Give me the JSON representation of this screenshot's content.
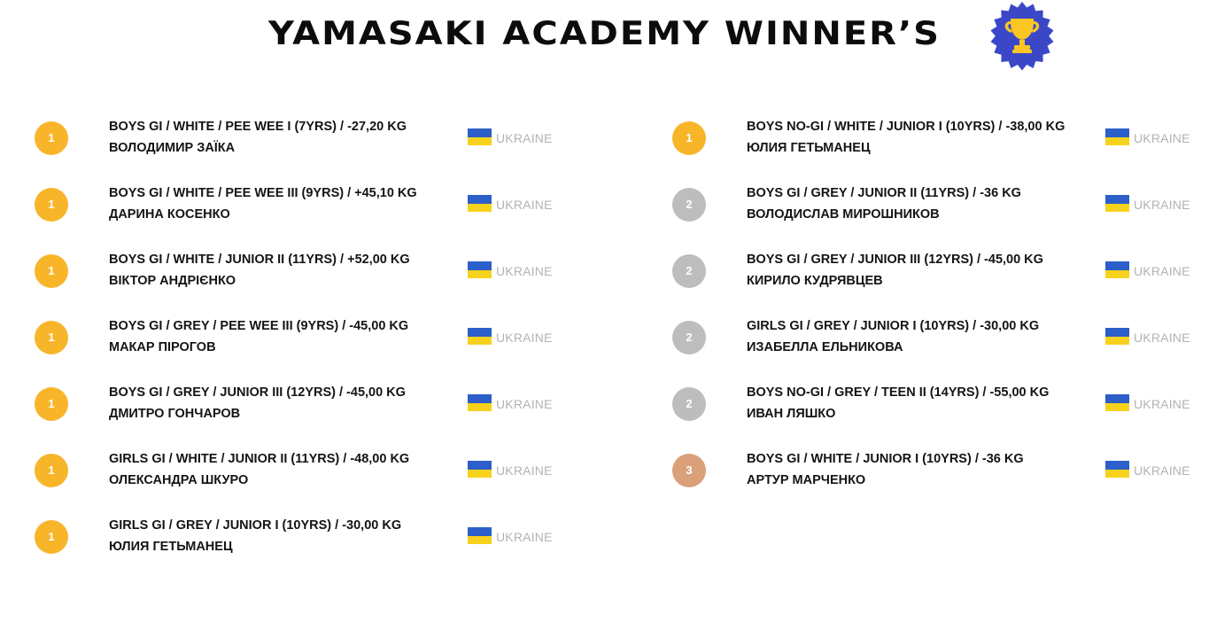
{
  "header": {
    "title": "YAMASAKI ACADEMY WINNER’S",
    "badge_icon": "trophy-icon",
    "badge_color": "#3a48c8",
    "trophy_color": "#f9c623"
  },
  "colors": {
    "gold": "#f9b529",
    "silver": "#bdbdbd",
    "bronze": "#d9a07a",
    "flag_blue": "#2c5fc9",
    "flag_yellow": "#f7d21c"
  },
  "results_left": [
    {
      "place": "1",
      "medal": "gold",
      "category": "BOYS GI / WHITE / PEE WEE I (7YRS) / -27,20 KG",
      "athlete": "ВОЛОДИМИР ЗАЇКА",
      "country": "UKRAINE"
    },
    {
      "place": "1",
      "medal": "gold",
      "category": "BOYS GI / WHITE / PEE WEE III (9YRS) / +45,10 KG",
      "athlete": "ДАРИНА КОСЕНКО",
      "country": "UKRAINE"
    },
    {
      "place": "1",
      "medal": "gold",
      "category": "BOYS GI / WHITE / JUNIOR II (11YRS) / +52,00 KG",
      "athlete": "ВІКТОР АНДРІЄНКО",
      "country": "UKRAINE"
    },
    {
      "place": "1",
      "medal": "gold",
      "category": "BOYS GI / GREY / PEE WEE III (9YRS) / -45,00 KG",
      "athlete": "МАКАР ПІРОГОВ",
      "country": "UKRAINE"
    },
    {
      "place": "1",
      "medal": "gold",
      "category": "BOYS GI / GREY / JUNIOR III (12YRS) / -45,00 KG",
      "athlete": "ДМИТРО ГОНЧАРОВ",
      "country": "UKRAINE"
    },
    {
      "place": "1",
      "medal": "gold",
      "category": "GIRLS GI / WHITE / JUNIOR II (11YRS) / -48,00 KG",
      "athlete": "ОЛЕКСАНДРА ШКУРО",
      "country": "UKRAINE"
    },
    {
      "place": "1",
      "medal": "gold",
      "category": "GIRLS GI / GREY / JUNIOR I (10YRS) / -30,00 KG",
      "athlete": "ЮЛИЯ ГЕТЬМАНЕЦ",
      "country": "UKRAINE"
    }
  ],
  "results_right": [
    {
      "place": "1",
      "medal": "gold",
      "category": "BOYS NO-GI / WHITE / JUNIOR I (10YRS) / -38,00 KG",
      "athlete": "ЮЛИЯ ГЕТЬМАНЕЦ",
      "country": "UKRAINE"
    },
    {
      "place": "2",
      "medal": "silver",
      "category": "BOYS GI / GREY / JUNIOR II (11YRS) / -36 KG",
      "athlete": "ВОЛОДИСЛАВ МИРОШНИКОВ",
      "country": "UKRAINE"
    },
    {
      "place": "2",
      "medal": "silver",
      "category": "BOYS GI / GREY / JUNIOR III (12YRS) / -45,00 KG",
      "athlete": "КИРИЛО КУДРЯВЦЕВ",
      "country": "UKRAINE"
    },
    {
      "place": "2",
      "medal": "silver",
      "category": "GIRLS GI / GREY / JUNIOR I (10YRS) / -30,00 KG",
      "athlete": "ИЗАБЕЛЛА ЕЛЬНИКОВА",
      "country": "UKRAINE"
    },
    {
      "place": "2",
      "medal": "silver",
      "category": "BOYS NO-GI / GREY / TEEN II (14YRS) / -55,00 KG",
      "athlete": "ИВАН ЛЯШКО",
      "country": "UKRAINE"
    },
    {
      "place": "3",
      "medal": "bronze",
      "category": "BOYS GI / WHITE / JUNIOR I (10YRS) / -36 KG",
      "athlete": "АРТУР МАРЧЕНКО",
      "country": "UKRAINE"
    }
  ]
}
